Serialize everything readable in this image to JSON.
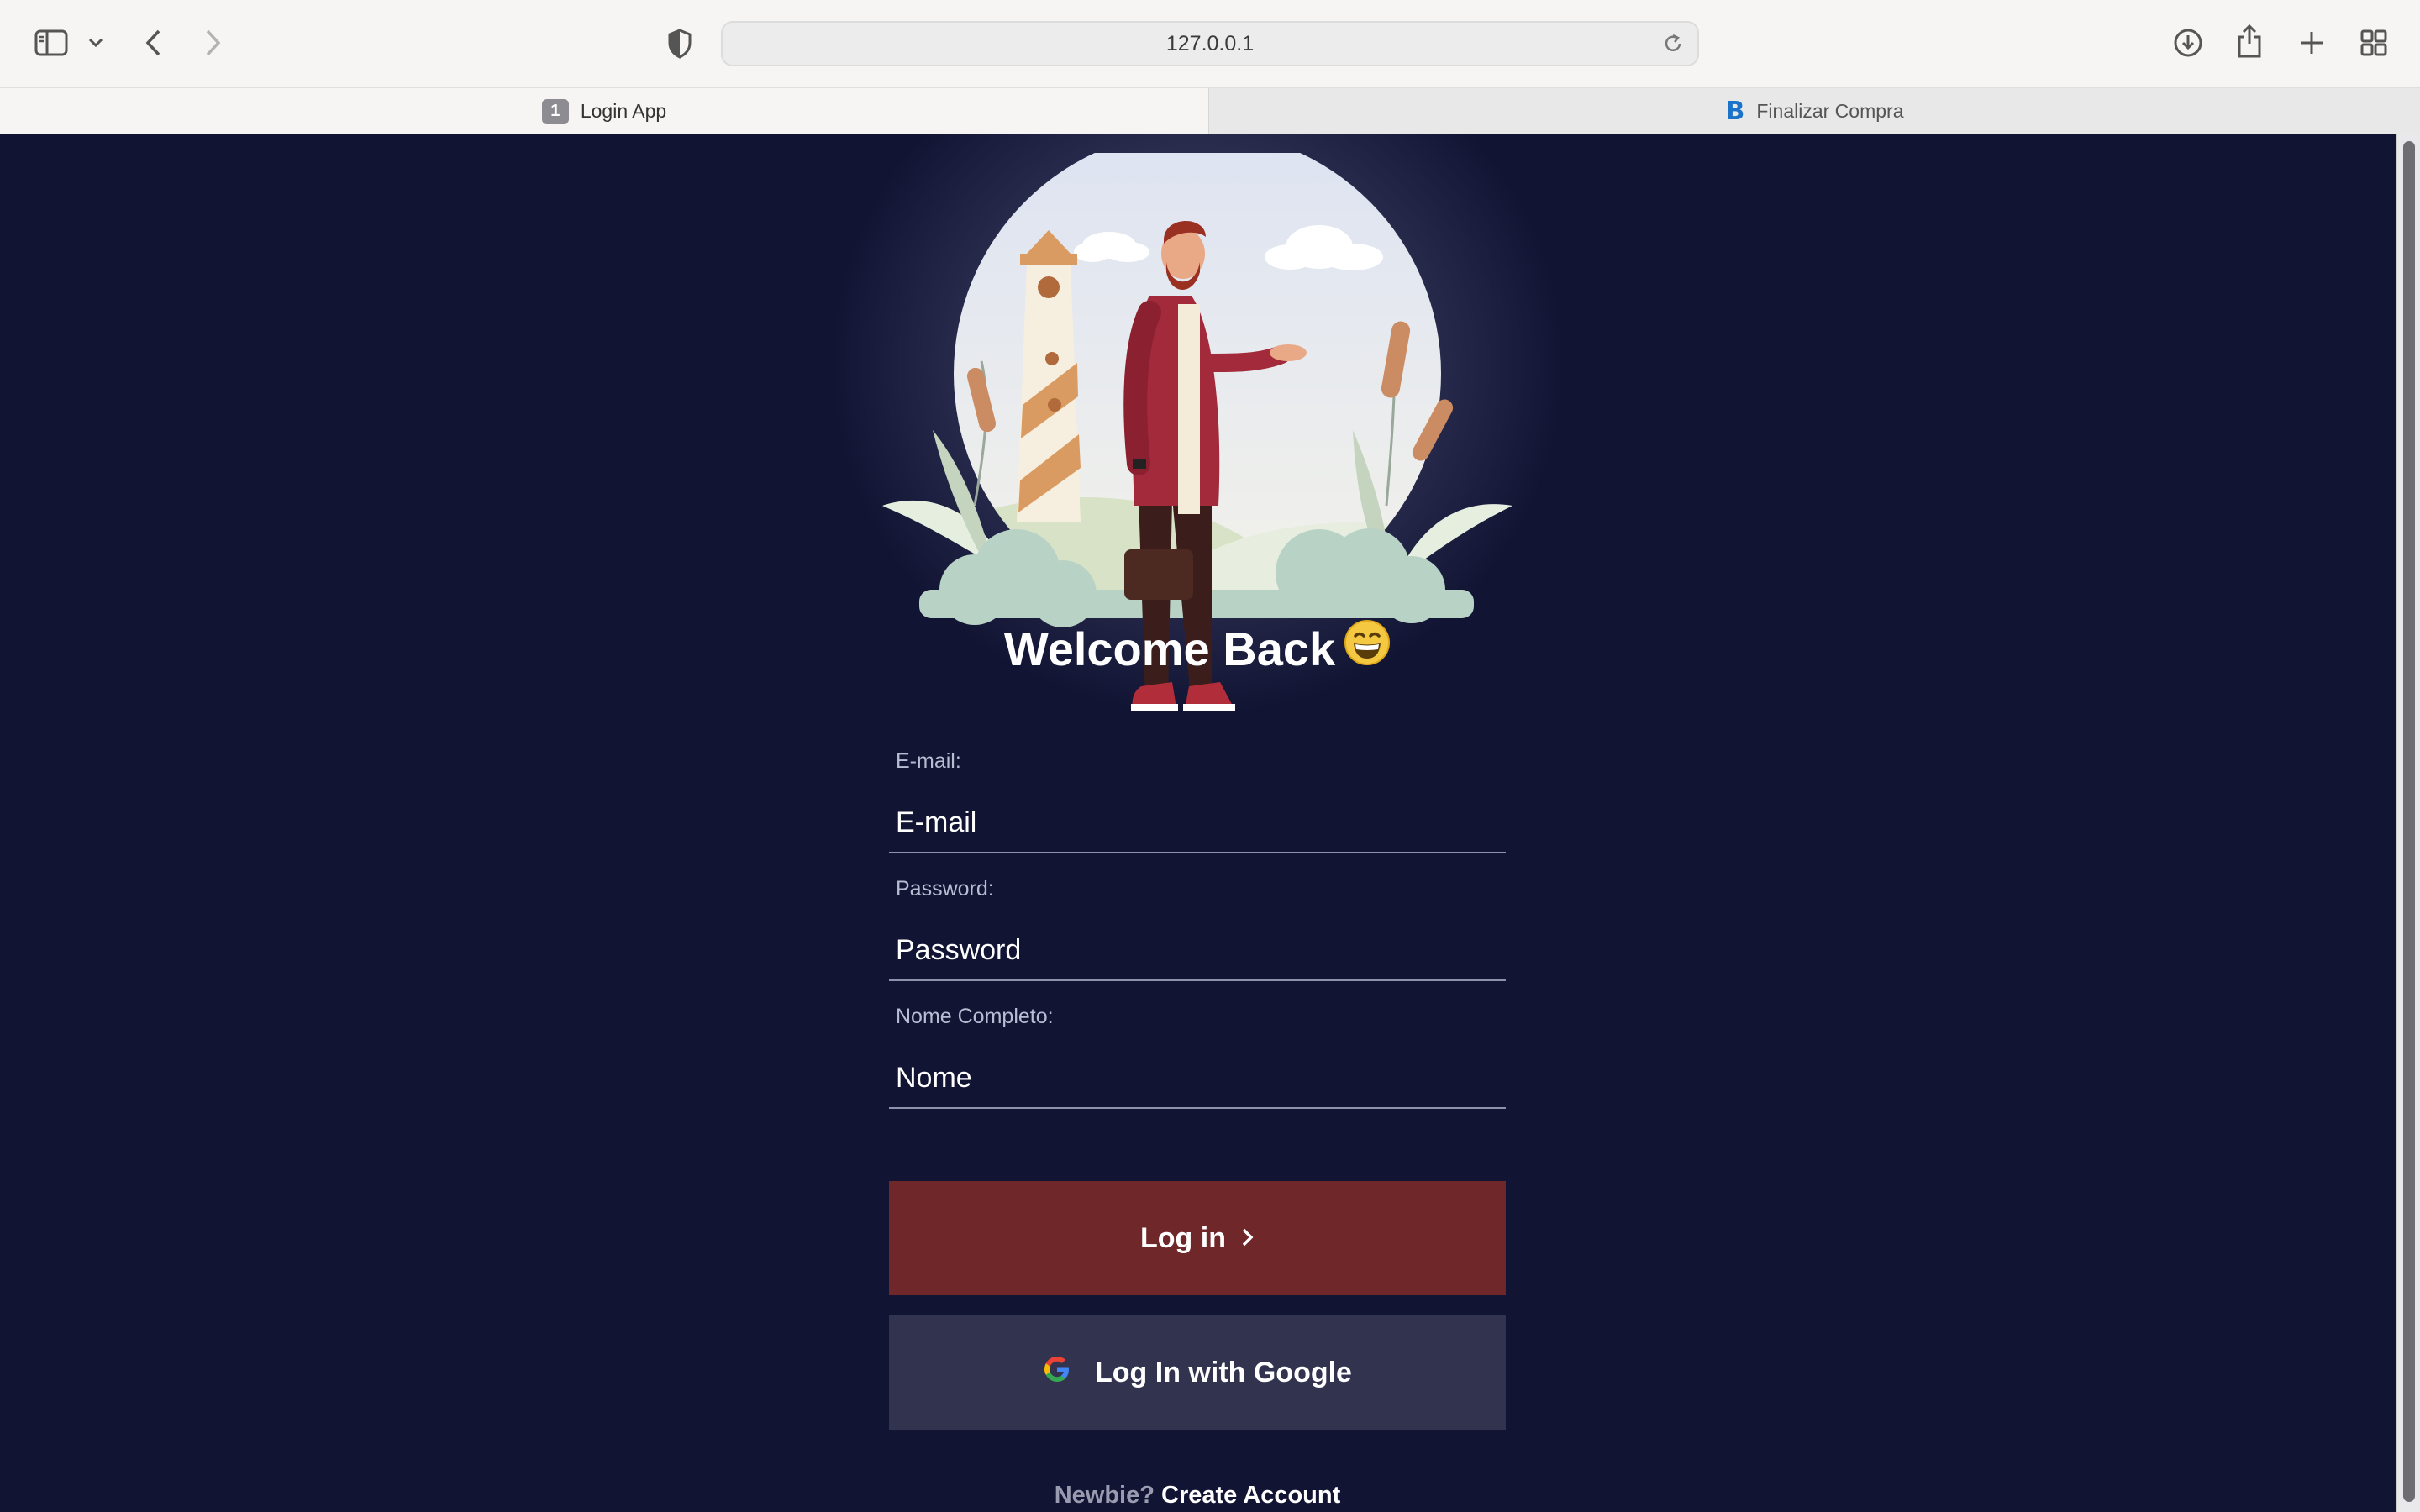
{
  "browser": {
    "url": "127.0.0.1",
    "tabs": [
      {
        "badge": "1",
        "label": "Login App"
      },
      {
        "favicon": "B",
        "label": "Finalizar Compra"
      }
    ]
  },
  "icons": {
    "sidebar": "sidebar-icon",
    "tab_group": "chevron-down-icon",
    "back": "chevron-left-icon",
    "forward": "chevron-right-icon",
    "privacy": "shield-icon",
    "reload": "reload-icon",
    "downloads": "download-icon",
    "share": "share-icon",
    "new_tab": "plus-icon",
    "tab_overview": "grid-icon",
    "emoji": "grinning-face-icon",
    "login_arrow": "chevron-right-icon",
    "google": "google-icon"
  },
  "colors": {
    "page_background": "#111433",
    "login_button": "#6f2729",
    "google_button": "#32344f"
  },
  "login": {
    "heading": "Welcome Back",
    "email": {
      "label": "E-mail:",
      "placeholder": "E-mail"
    },
    "password": {
      "label": "Password:",
      "placeholder": "Password"
    },
    "name": {
      "label": "Nome Completo:",
      "placeholder": "Nome"
    },
    "login_button": "Log in",
    "google_button": "Log In with Google",
    "signup_prompt": "Newbie?",
    "signup_link": "Create Account"
  }
}
